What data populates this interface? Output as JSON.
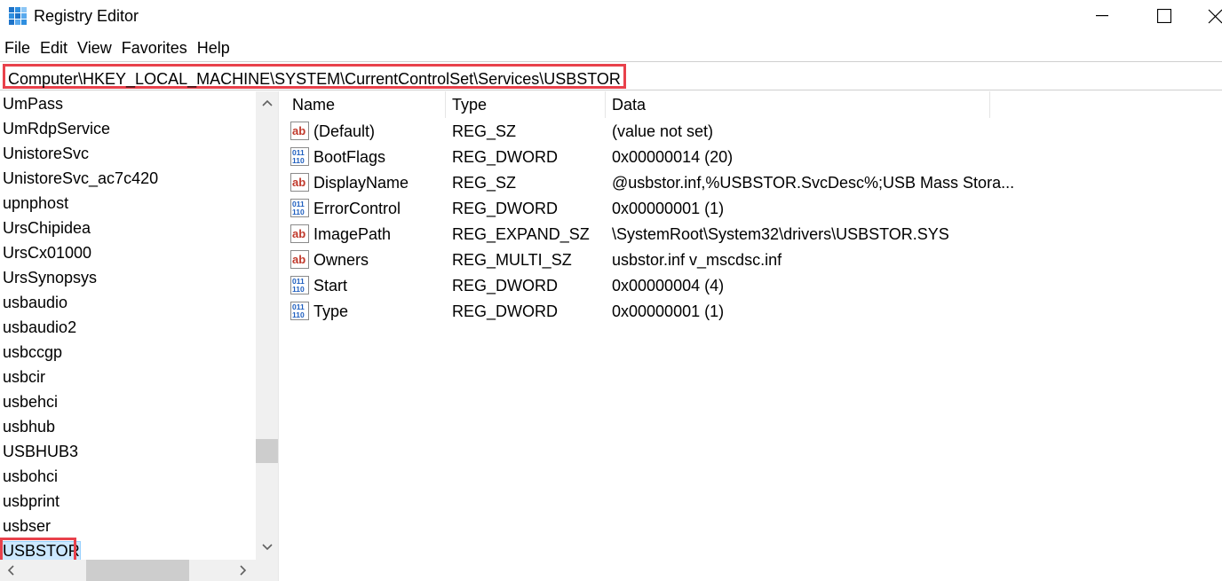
{
  "window": {
    "title": "Registry Editor"
  },
  "menu": [
    "File",
    "Edit",
    "View",
    "Favorites",
    "Help"
  ],
  "address": {
    "path": "Computer\\HKEY_LOCAL_MACHINE\\SYSTEM\\CurrentControlSet\\Services\\USBSTOR"
  },
  "tree": {
    "items": [
      "UmPass",
      "UmRdpService",
      "UnistoreSvc",
      "UnistoreSvc_ac7c420",
      "upnphost",
      "UrsChipidea",
      "UrsCx01000",
      "UrsSynopsys",
      "usbaudio",
      "usbaudio2",
      "usbccgp",
      "usbcir",
      "usbehci",
      "usbhub",
      "USBHUB3",
      "usbohci",
      "usbprint",
      "usbser",
      "USBSTOR"
    ],
    "selected": "USBSTOR"
  },
  "columns": {
    "name": "Name",
    "type": "Type",
    "data": "Data"
  },
  "values": [
    {
      "icon": "string-value-icon",
      "name": "(Default)",
      "type": "REG_SZ",
      "data": "(value not set)"
    },
    {
      "icon": "binary-value-icon",
      "name": "BootFlags",
      "type": "REG_DWORD",
      "data": "0x00000014 (20)"
    },
    {
      "icon": "string-value-icon",
      "name": "DisplayName",
      "type": "REG_SZ",
      "data": "@usbstor.inf,%USBSTOR.SvcDesc%;USB Mass Stora..."
    },
    {
      "icon": "binary-value-icon",
      "name": "ErrorControl",
      "type": "REG_DWORD",
      "data": "0x00000001 (1)"
    },
    {
      "icon": "string-value-icon",
      "name": "ImagePath",
      "type": "REG_EXPAND_SZ",
      "data": "\\SystemRoot\\System32\\drivers\\USBSTOR.SYS"
    },
    {
      "icon": "string-value-icon",
      "name": "Owners",
      "type": "REG_MULTI_SZ",
      "data": "usbstor.inf v_mscdsc.inf"
    },
    {
      "icon": "binary-value-icon",
      "name": "Start",
      "type": "REG_DWORD",
      "data": "0x00000004 (4)"
    },
    {
      "icon": "binary-value-icon",
      "name": "Type",
      "type": "REG_DWORD",
      "data": "0x00000001 (1)"
    }
  ],
  "colors": {
    "highlight_border": "#e8414b",
    "selection_bg": "#cce8ff"
  }
}
